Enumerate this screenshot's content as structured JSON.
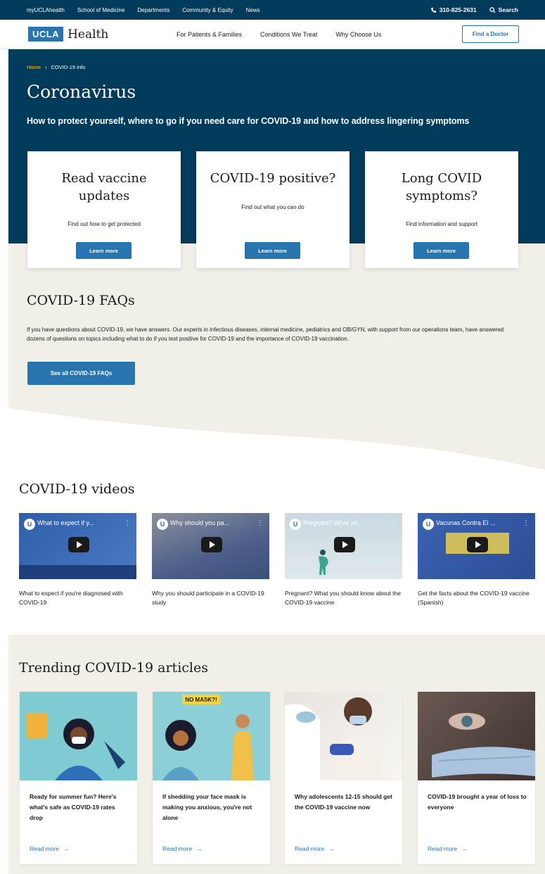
{
  "utility": {
    "links": [
      "myUCLAhealth",
      "School of Medicine",
      "Departments",
      "Community & Equity",
      "News"
    ],
    "phone": "310-825-2631",
    "search": "Search"
  },
  "header": {
    "logo_box": "UCLA",
    "logo_text": "Health",
    "nav": [
      "For Patients & Families",
      "Conditions We Treat",
      "Why Choose Us"
    ],
    "find_doctor": "Find a Doctor"
  },
  "hero": {
    "breadcrumb": {
      "home": "Home",
      "current": "COVID-19 info"
    },
    "title": "Coronavirus",
    "subtitle": "How to protect yourself, where to go if you need care for COVID-19 and how to address lingering symptoms"
  },
  "cards": [
    {
      "title_line1": "Read vaccine",
      "title_line2": "updates",
      "text": "Find out how to get protected",
      "button": "Learn more"
    },
    {
      "title_line1": "COVID-19 positive?",
      "title_line2": "",
      "text": "Find out what you can do",
      "button": "Learn more"
    },
    {
      "title_line1": "Long COVID",
      "title_line2": "symptoms?",
      "text": "Find information and support",
      "button": "Learn more"
    }
  ],
  "faq": {
    "title": "COVID-19 FAQs",
    "text": "If you have questions about COVID-19, we have answers. Our experts in infectious diseases, internal medicine, pediatrics and OB/GYN, with support from our operations team, have answered dozens of questions on topics including what to do if you test positive for COVID-19 and the importance of COVID-19 vaccination.",
    "button": "See all COVID-19 FAQs"
  },
  "videos": {
    "title": "COVID-19 videos",
    "items": [
      {
        "thumb_title": "What to expect if y...",
        "caption": "What to expect if you're diagnosed with COVID-19"
      },
      {
        "thumb_title": "Why should you pa...",
        "caption": "Why you should participate in a COVID-19 study"
      },
      {
        "thumb_title": "Pregnant? What yo...",
        "caption": "Pregnant? What you should know about the COVID-19 vaccine"
      },
      {
        "thumb_title": "Vacunas Contra El ...",
        "caption": "Get the facts about the COVID-19 vaccine (Spanish)"
      }
    ]
  },
  "trending": {
    "title": "Trending COVID-19 articles",
    "read_more": "Read more",
    "sign_text": "NO MASK?!",
    "items": [
      {
        "title": "Ready for summer fun? Here's what's safe as COVID-19 rates drop"
      },
      {
        "title": "If shedding your face mask is making you anxious, you're not alone"
      },
      {
        "title": "Why adolescents 12-15 should get the COVID-19 vaccine now"
      },
      {
        "title": "COVID-19 brought a year of loss to everyone"
      }
    ]
  },
  "colors": {
    "navy": "#003b5c",
    "blue": "#2774ae",
    "beige": "#f2efe9",
    "gold": "#ffd100"
  }
}
